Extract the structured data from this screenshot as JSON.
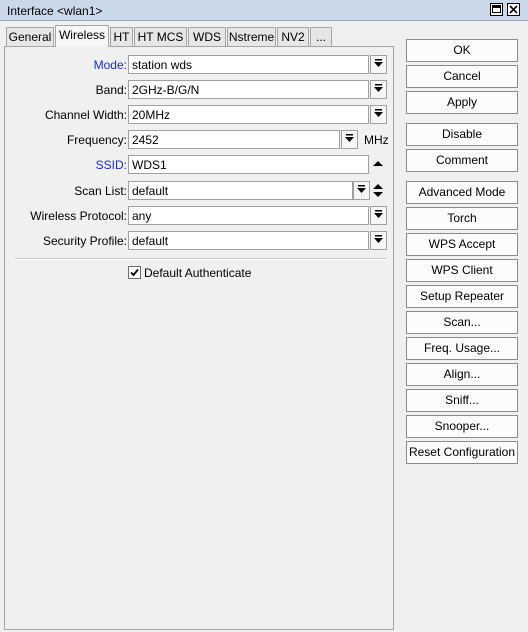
{
  "window": {
    "title": "Interface <wlan1>"
  },
  "tabs": [
    {
      "label": "General"
    },
    {
      "label": "Wireless"
    },
    {
      "label": "HT"
    },
    {
      "label": "HT MCS"
    },
    {
      "label": "WDS"
    },
    {
      "label": "Nstreme"
    },
    {
      "label": "NV2"
    },
    {
      "label": "..."
    }
  ],
  "form": {
    "mode": {
      "label": "Mode:",
      "value": "station wds"
    },
    "band": {
      "label": "Band:",
      "value": "2GHz-B/G/N"
    },
    "channel_width": {
      "label": "Channel Width:",
      "value": "20MHz"
    },
    "frequency": {
      "label": "Frequency:",
      "value": "2452",
      "unit": "MHz"
    },
    "ssid": {
      "label": "SSID:",
      "value": "WDS1"
    },
    "scan_list": {
      "label": "Scan List:",
      "value": "default"
    },
    "wireless_protocol": {
      "label": "Wireless Protocol:",
      "value": "any"
    },
    "security_profile": {
      "label": "Security Profile:",
      "value": "default"
    },
    "default_authenticate": {
      "label": "Default Authenticate",
      "checked": true
    }
  },
  "buttons": [
    {
      "label": "OK"
    },
    {
      "label": "Cancel"
    },
    {
      "label": "Apply"
    },
    {
      "label": "Disable"
    },
    {
      "label": "Comment"
    },
    {
      "label": "Advanced Mode"
    },
    {
      "label": "Torch"
    },
    {
      "label": "WPS Accept"
    },
    {
      "label": "WPS Client"
    },
    {
      "label": "Setup Repeater"
    },
    {
      "label": "Scan..."
    },
    {
      "label": "Freq. Usage..."
    },
    {
      "label": "Align..."
    },
    {
      "label": "Sniff..."
    },
    {
      "label": "Snooper..."
    },
    {
      "label": "Reset Configuration"
    }
  ],
  "colors": {
    "titlebar": "#cad8ea",
    "label_highlight": "#1b2bd6",
    "window_bg": "#f0f0f0"
  }
}
